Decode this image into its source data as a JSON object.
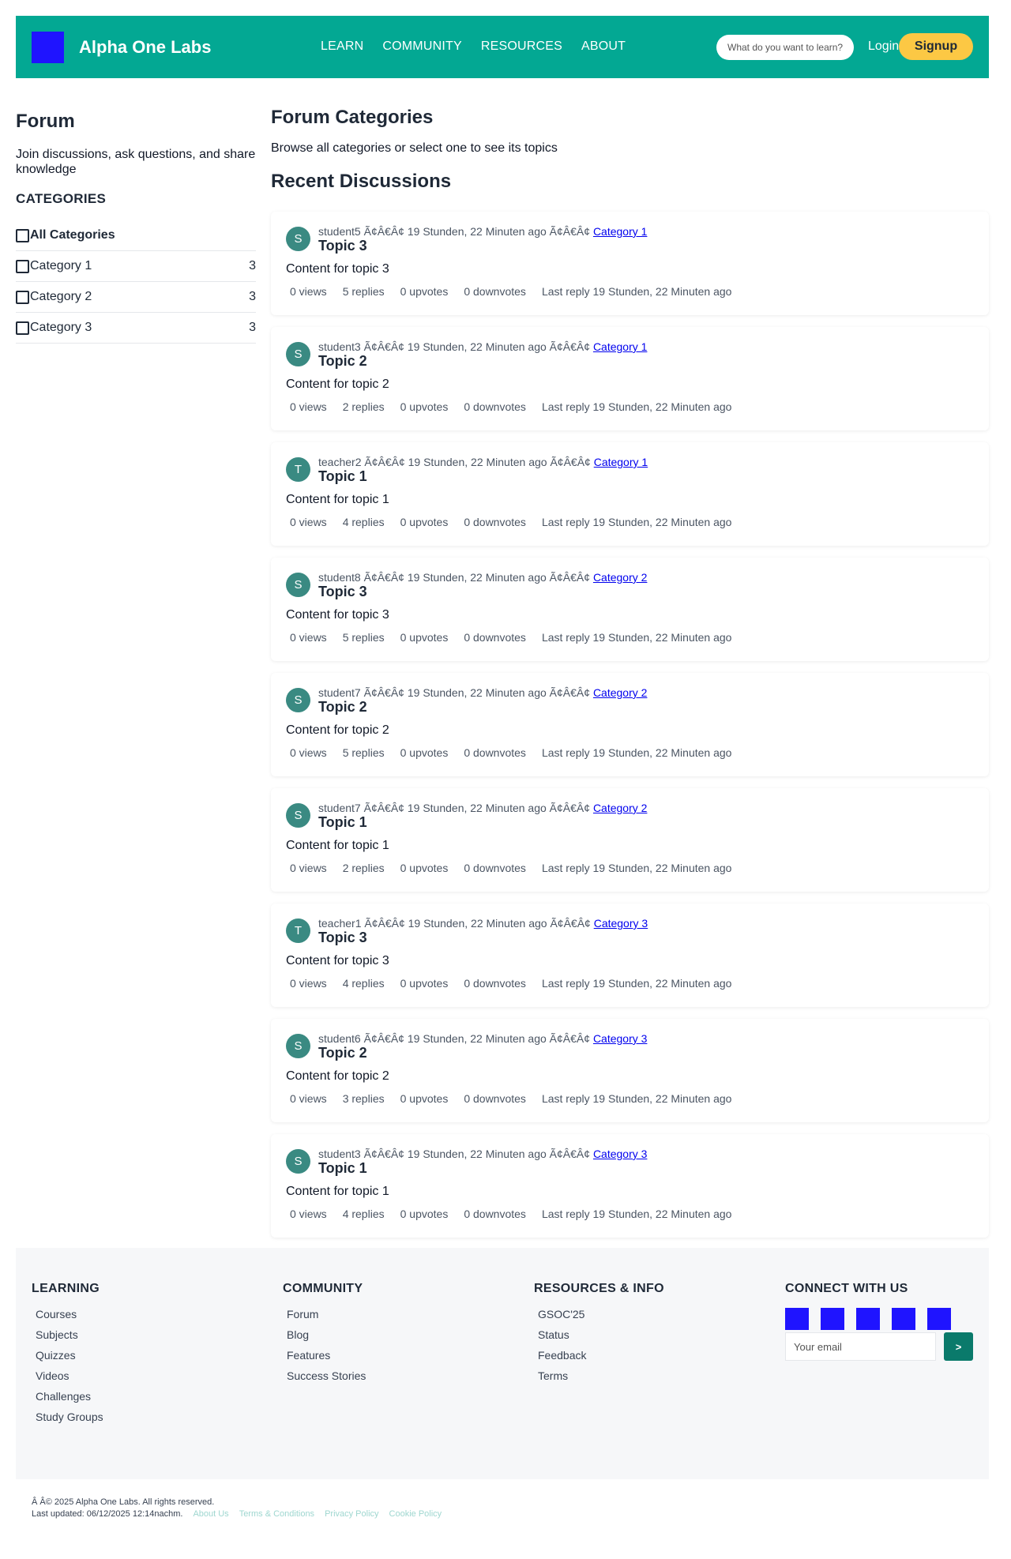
{
  "header": {
    "brand": "Alpha One Labs",
    "nav": [
      "LEARN",
      "COMMUNITY",
      "RESOURCES",
      "ABOUT"
    ],
    "search_placeholder": "What do you want to learn?",
    "login_label": "Login",
    "signup_label": "Signup",
    "brand_color": "#03a893",
    "accent_color": "#fcc844"
  },
  "sidebar": {
    "title": "Forum",
    "description": "Join discussions, ask questions, and share knowledge",
    "categories_heading": "CATEGORIES",
    "categories": [
      {
        "label": "All Categories",
        "count": ""
      },
      {
        "label": "Category 1",
        "count": "3"
      },
      {
        "label": "Category 2",
        "count": "3"
      },
      {
        "label": "Category 3",
        "count": "3"
      }
    ]
  },
  "main": {
    "title": "Forum Categories",
    "subtitle": "Browse all categories or select one to see its topics",
    "recent_heading": "Recent Discussions",
    "topics": [
      {
        "initial": "S",
        "meta": "student5 Ã¢Â€Â¢ 19 Stunden, 22 Minuten ago Ã¢Â€Â¢ ",
        "category": "Category 1",
        "title": "Topic 3",
        "content": "Content for topic 3",
        "views": "0 views",
        "replies": "5 replies",
        "upvotes": "0 upvotes",
        "downvotes": "0 downvotes",
        "last_reply": "Last reply 19 Stunden, 22 Minuten ago"
      },
      {
        "initial": "S",
        "meta": "student3 Ã¢Â€Â¢ 19 Stunden, 22 Minuten ago Ã¢Â€Â¢ ",
        "category": "Category 1",
        "title": "Topic 2",
        "content": "Content for topic 2",
        "views": "0 views",
        "replies": "2 replies",
        "upvotes": "0 upvotes",
        "downvotes": "0 downvotes",
        "last_reply": "Last reply 19 Stunden, 22 Minuten ago"
      },
      {
        "initial": "T",
        "meta": "teacher2 Ã¢Â€Â¢ 19 Stunden, 22 Minuten ago Ã¢Â€Â¢ ",
        "category": "Category 1",
        "title": "Topic 1",
        "content": "Content for topic 1",
        "views": "0 views",
        "replies": "4 replies",
        "upvotes": "0 upvotes",
        "downvotes": "0 downvotes",
        "last_reply": "Last reply 19 Stunden, 22 Minuten ago"
      },
      {
        "initial": "S",
        "meta": "student8 Ã¢Â€Â¢ 19 Stunden, 22 Minuten ago Ã¢Â€Â¢ ",
        "category": "Category 2",
        "title": "Topic 3",
        "content": "Content for topic 3",
        "views": "0 views",
        "replies": "5 replies",
        "upvotes": "0 upvotes",
        "downvotes": "0 downvotes",
        "last_reply": "Last reply 19 Stunden, 22 Minuten ago"
      },
      {
        "initial": "S",
        "meta": "student7 Ã¢Â€Â¢ 19 Stunden, 22 Minuten ago Ã¢Â€Â¢ ",
        "category": "Category 2",
        "title": "Topic 2",
        "content": "Content for topic 2",
        "views": "0 views",
        "replies": "5 replies",
        "upvotes": "0 upvotes",
        "downvotes": "0 downvotes",
        "last_reply": "Last reply 19 Stunden, 22 Minuten ago"
      },
      {
        "initial": "S",
        "meta": "student7 Ã¢Â€Â¢ 19 Stunden, 22 Minuten ago Ã¢Â€Â¢ ",
        "category": "Category 2",
        "title": "Topic 1",
        "content": "Content for topic 1",
        "views": "0 views",
        "replies": "2 replies",
        "upvotes": "0 upvotes",
        "downvotes": "0 downvotes",
        "last_reply": "Last reply 19 Stunden, 22 Minuten ago"
      },
      {
        "initial": "T",
        "meta": "teacher1 Ã¢Â€Â¢ 19 Stunden, 22 Minuten ago Ã¢Â€Â¢ ",
        "category": "Category 3",
        "title": "Topic 3",
        "content": "Content for topic 3",
        "views": "0 views",
        "replies": "4 replies",
        "upvotes": "0 upvotes",
        "downvotes": "0 downvotes",
        "last_reply": "Last reply 19 Stunden, 22 Minuten ago"
      },
      {
        "initial": "S",
        "meta": "student6 Ã¢Â€Â¢ 19 Stunden, 22 Minuten ago Ã¢Â€Â¢ ",
        "category": "Category 3",
        "title": "Topic 2",
        "content": "Content for topic 2",
        "views": "0 views",
        "replies": "3 replies",
        "upvotes": "0 upvotes",
        "downvotes": "0 downvotes",
        "last_reply": "Last reply 19 Stunden, 22 Minuten ago"
      },
      {
        "initial": "S",
        "meta": "student3 Ã¢Â€Â¢ 19 Stunden, 22 Minuten ago Ã¢Â€Â¢ ",
        "category": "Category 3",
        "title": "Topic 1",
        "content": "Content for topic 1",
        "views": "0 views",
        "replies": "4 replies",
        "upvotes": "0 upvotes",
        "downvotes": "0 downvotes",
        "last_reply": "Last reply 19 Stunden, 22 Minuten ago"
      }
    ]
  },
  "footer": {
    "learning": {
      "heading": "LEARNING",
      "links": [
        "Courses",
        "Subjects",
        "Quizzes",
        "Videos",
        "Challenges",
        "Study Groups"
      ]
    },
    "community": {
      "heading": "COMMUNITY",
      "links": [
        "Forum",
        "Blog",
        "Features",
        "Success Stories"
      ]
    },
    "resources": {
      "heading": "RESOURCES & INFO",
      "links": [
        "GSOC'25",
        "Status",
        "Feedback",
        "Terms"
      ]
    },
    "connect": {
      "heading": "CONNECT WITH US",
      "social_icons": [
        "social-icon",
        "social-icon",
        "social-icon",
        "social-icon",
        "social-icon"
      ],
      "email_placeholder": "Your email",
      "submit_label": ">"
    },
    "copyright": "Â   Â© 2025 Alpha One Labs. All rights reserved.",
    "last_updated": "Last updated: 06/12/2025 12:14nachm.",
    "bottom_links": [
      "About Us",
      "Terms & Conditions",
      "Privacy Policy",
      "Cookie Policy"
    ]
  }
}
